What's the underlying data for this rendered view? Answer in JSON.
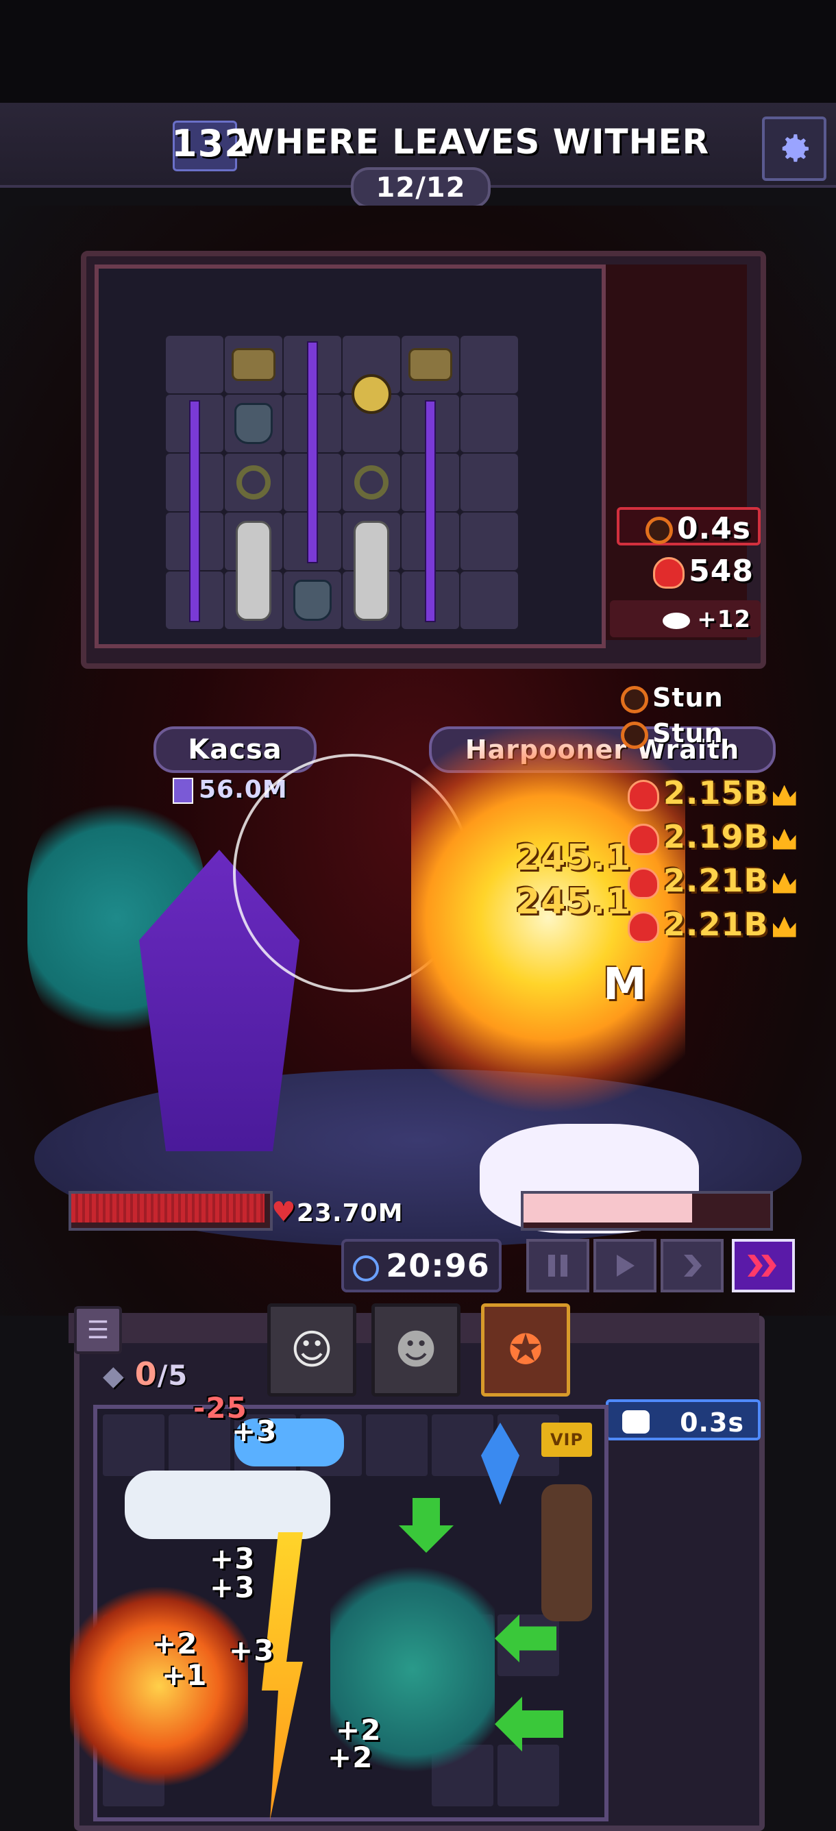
{
  "header": {
    "level": "132",
    "stage_title": "WHERE LEAVES WITHER",
    "wave": "12/12",
    "settings_icon": "gear-icon"
  },
  "battle": {
    "player": {
      "name": "Kacsa",
      "power": "56.0M",
      "hp": "23.70M",
      "hp_fraction": 1.0
    },
    "enemy": {
      "name": "Harpooner Wraith",
      "hp_fraction": 0.7
    },
    "enemy_status": {
      "stun_timer": "0.4s",
      "stun_value": "548",
      "wing_count": "+12"
    },
    "status_labels": [
      "Stun",
      "Stun"
    ],
    "damage_numbers": [
      "2.15B",
      "2.19B",
      "2.21B",
      "2.21B"
    ],
    "player_damage_fragments": [
      "245.1",
      "245.1",
      "M"
    ],
    "timer": "20:96",
    "controls": [
      "pause",
      "play",
      "fast",
      "faster"
    ]
  },
  "backpack": {
    "gems": "0",
    "gems_max": "/5",
    "cooldown": "0.3s",
    "floating_numbers": [
      "-25",
      "+3",
      "+3",
      "+3",
      "+3",
      "+2",
      "+1",
      "+2",
      "+2"
    ],
    "vip_label": "VIP"
  },
  "colors": {
    "accent": "#7a3ad6",
    "danger": "#d8262f",
    "gold": "#ffd24a"
  }
}
